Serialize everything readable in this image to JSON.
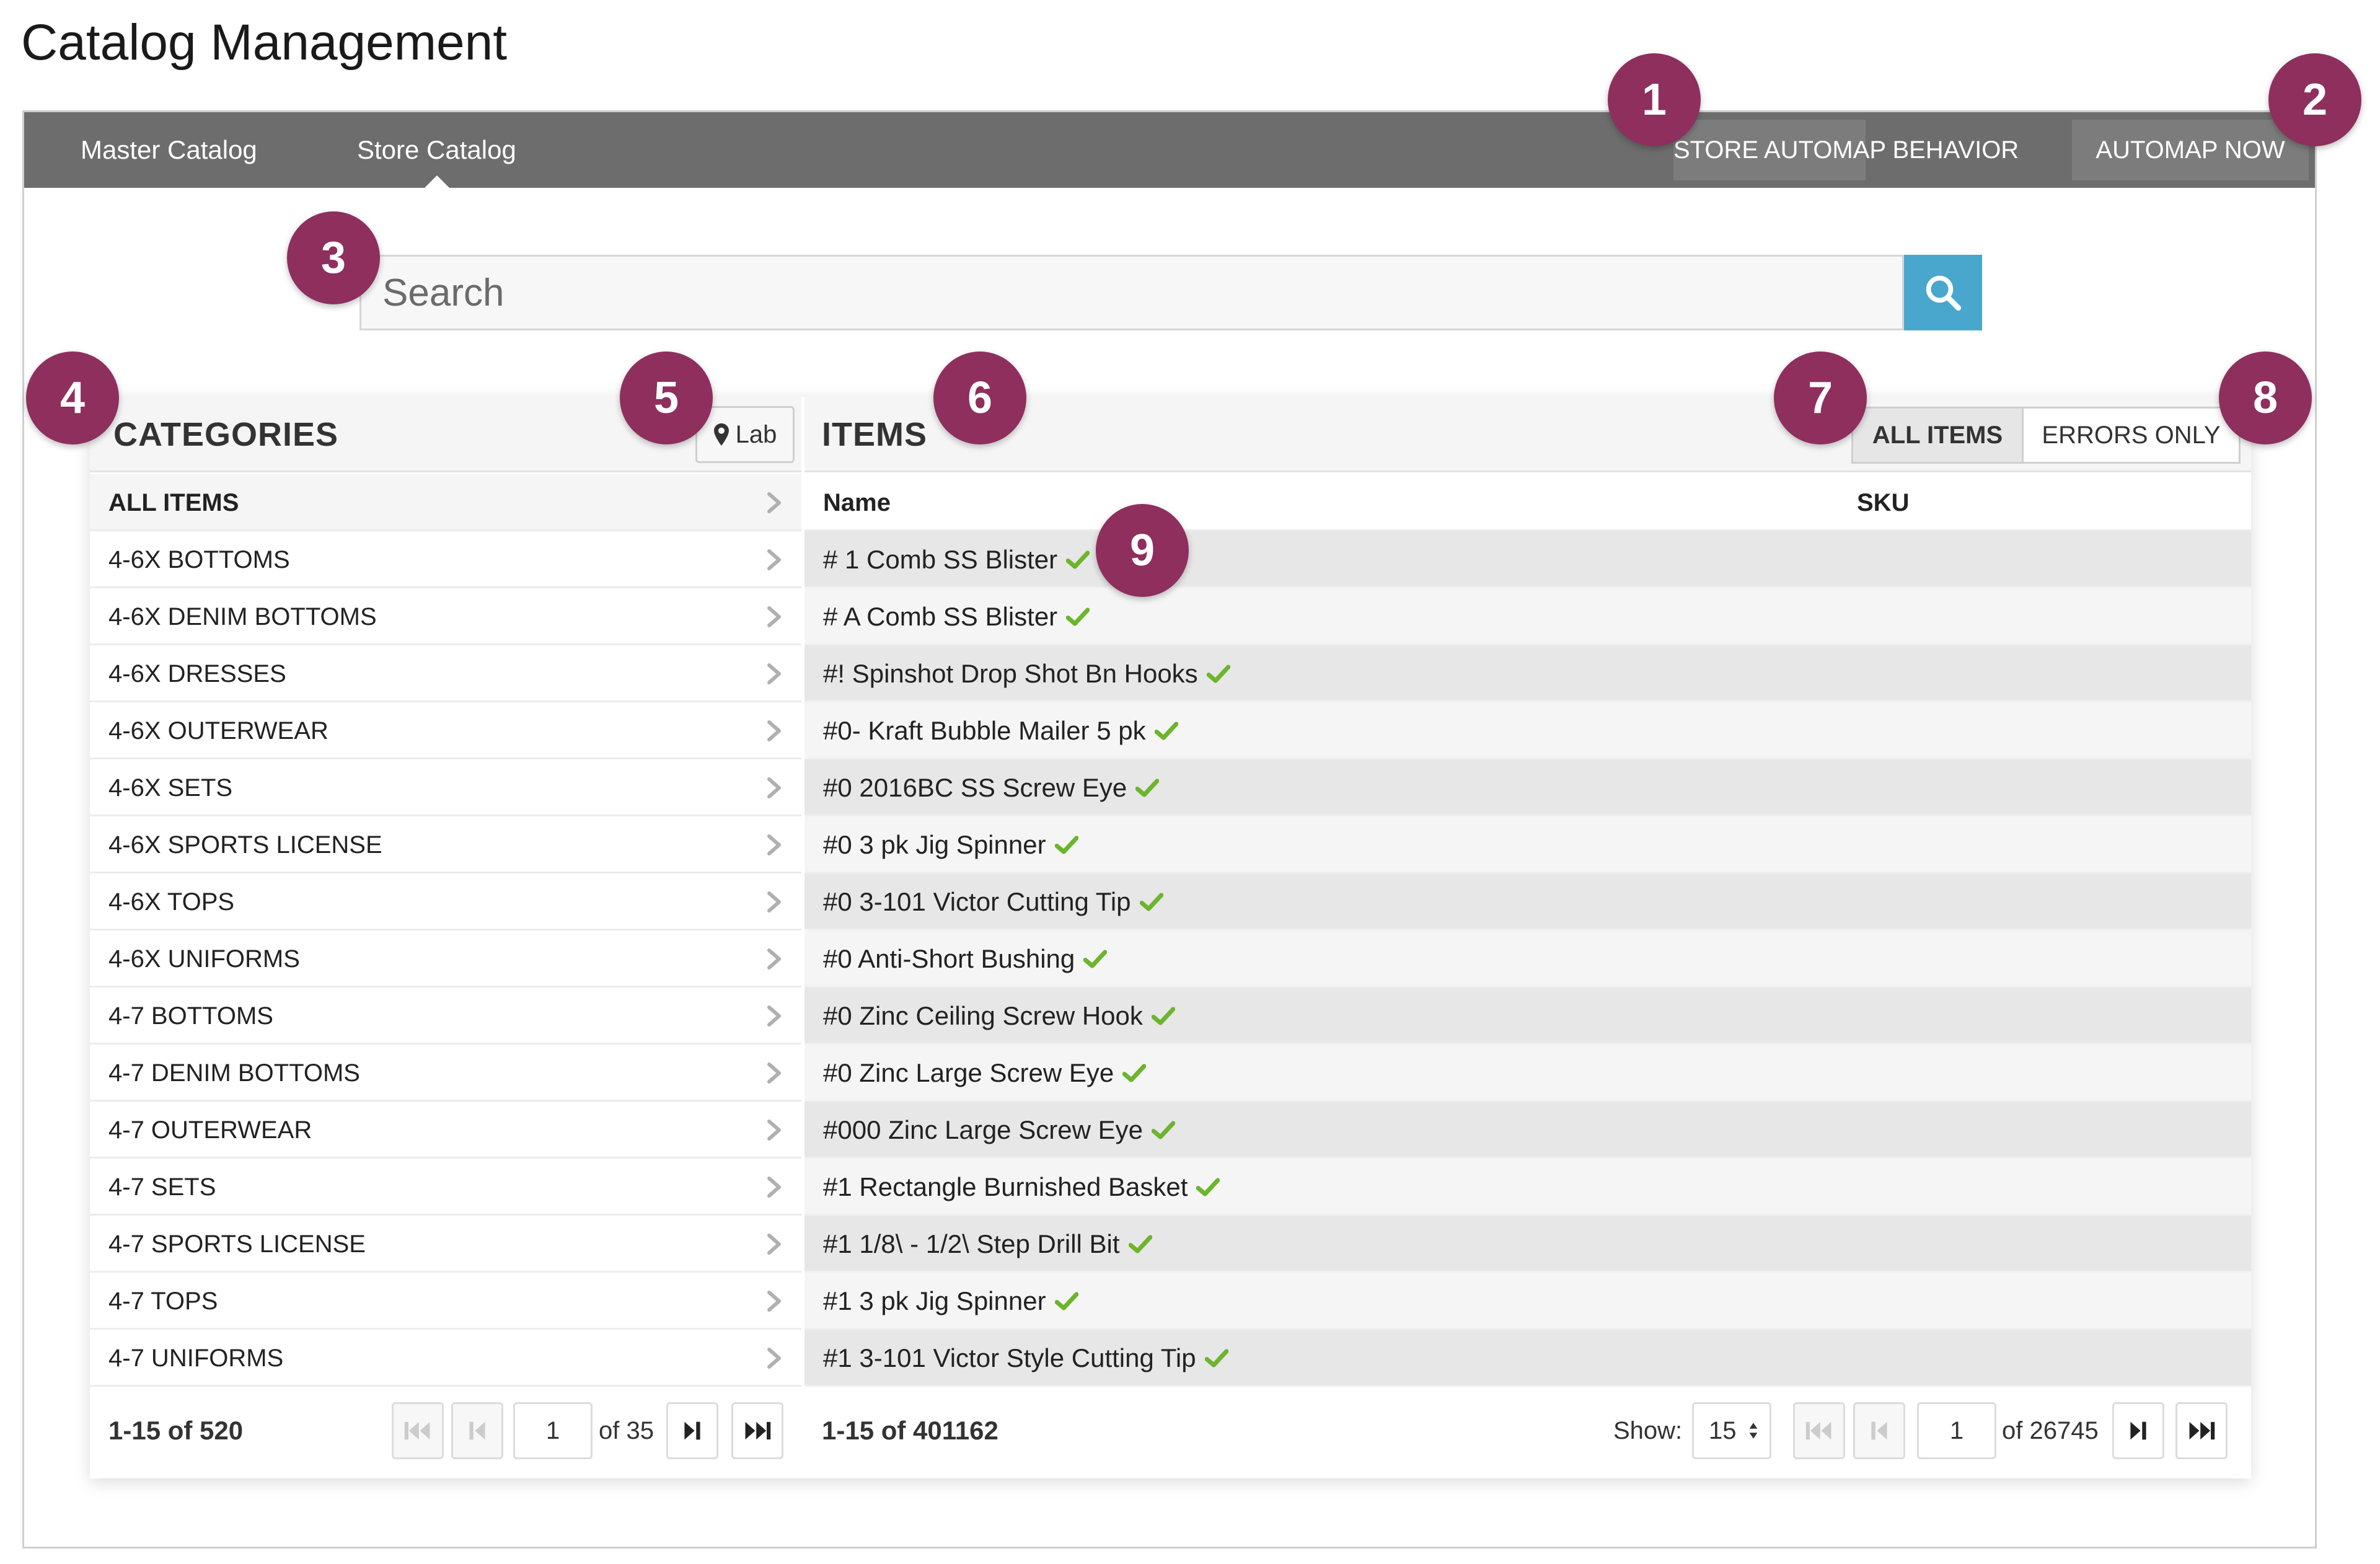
{
  "page_title": "Catalog Management",
  "nav": {
    "tabs": [
      {
        "label": "Master Catalog"
      },
      {
        "label": "Store Catalog"
      }
    ],
    "active_tab": "Store Catalog",
    "automap_behavior_label": "STORE AUTOMAP BEHAVIOR",
    "automap_now_label": "AUTOMAP NOW"
  },
  "search": {
    "placeholder": "Search",
    "value": "",
    "icon": "search-icon"
  },
  "categories": {
    "title": "CATEGORIES",
    "location_label": "Lab",
    "location_icon": "map-marker-icon",
    "items": [
      "ALL ITEMS",
      "4-6X BOTTOMS",
      "4-6X DENIM BOTTOMS",
      "4-6X DRESSES",
      "4-6X OUTERWEAR",
      "4-6X SETS",
      "4-6X SPORTS LICENSE",
      "4-6X TOPS",
      "4-6X UNIFORMS",
      "4-7 BOTTOMS",
      "4-7 DENIM BOTTOMS",
      "4-7 OUTERWEAR",
      "4-7 SETS",
      "4-7 SPORTS LICENSE",
      "4-7 TOPS",
      "4-7 UNIFORMS"
    ],
    "pager": {
      "summary": "1-15 of 520",
      "page": "1",
      "of_label": "of 35"
    }
  },
  "items": {
    "title": "ITEMS",
    "filter_all_label": "ALL ITEMS",
    "filter_errors_label": "ERRORS ONLY",
    "columns": {
      "name": "Name",
      "sku": "SKU"
    },
    "rows": [
      "# 1 Comb SS Blister",
      "# A Comb SS Blister",
      "#! Spinshot Drop Shot Bn Hooks",
      "#0- Kraft Bubble Mailer 5 pk",
      "#0 2016BC SS Screw Eye",
      "#0 3 pk Jig Spinner",
      "#0 3-101 Victor Cutting Tip",
      "#0 Anti-Short Bushing",
      "#0 Zinc Ceiling Screw Hook",
      "#0 Zinc Large Screw Eye",
      "#000 Zinc Large Screw Eye",
      "#1 Rectangle Burnished Basket",
      "#1 1/8\\ - 1/2\\ Step Drill Bit",
      "#1 3 pk Jig Spinner",
      "#1 3-101 Victor Style Cutting Tip"
    ],
    "status_icon": "check-icon",
    "pager": {
      "summary": "1-15 of 401162",
      "show_label": "Show:",
      "show_value": "15",
      "page": "1",
      "of_label": "of 26745"
    }
  },
  "callouts": [
    "1",
    "2",
    "3",
    "4",
    "5",
    "6",
    "7",
    "8",
    "9"
  ],
  "colors": {
    "topbar": "#6d6d6d",
    "search_button": "#49a6cc",
    "callout": "#8e2f5d",
    "check": "#6cb52d"
  }
}
